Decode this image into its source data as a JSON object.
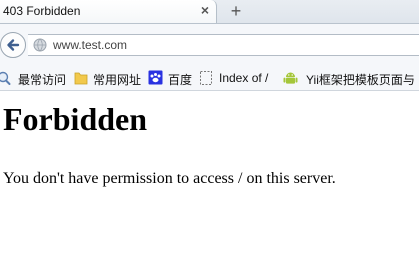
{
  "browser": {
    "tab": {
      "title": "403 Forbidden",
      "close_glyph": "×"
    },
    "new_tab_glyph": "+",
    "url": "www.test.com",
    "icons": {
      "back": "back-arrow-icon",
      "site": "globe-icon",
      "close": "close-icon",
      "new_tab": "plus-icon"
    },
    "bookmarks": [
      {
        "label": "最常访问",
        "icon": "magnifier-icon"
      },
      {
        "label": "常用网址",
        "icon": "folder-icon"
      },
      {
        "label": "百度",
        "icon": "paw-icon"
      },
      {
        "label": "Index of /",
        "icon": "blank-page-icon"
      },
      {
        "label": "Yii框架把模板页面与",
        "icon": "android-icon"
      }
    ]
  },
  "page": {
    "heading": "Forbidden",
    "message": "You don't have permission to access / on this server."
  },
  "colors": {
    "accent_back_arrow": "#4a6fa5",
    "folder": "#f2c94c",
    "baidu": "#2932e1",
    "android": "#a4c639"
  }
}
